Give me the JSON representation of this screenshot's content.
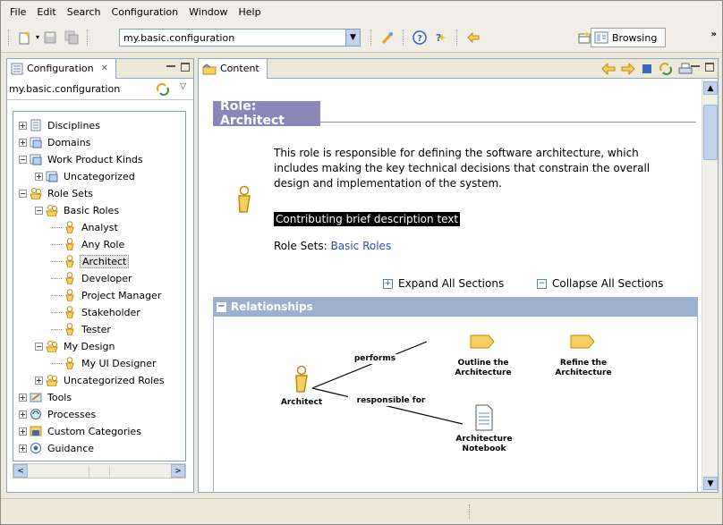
{
  "menubar": {
    "items": [
      {
        "label": "File"
      },
      {
        "label": "Edit"
      },
      {
        "label": "Search"
      },
      {
        "label": "Configuration"
      },
      {
        "label": "Window"
      },
      {
        "label": "Help"
      }
    ]
  },
  "toolbar": {
    "config_combo_value": "my.basic.configuration",
    "perspective_label": "Browsing",
    "overflow": "»"
  },
  "library_view": {
    "tab_label": "Configuration",
    "config_name": "my.basic.configuration",
    "tree": [
      {
        "label": "Disciplines",
        "level": 0,
        "expander": "+"
      },
      {
        "label": "Domains",
        "level": 0,
        "expander": "+"
      },
      {
        "label": "Work Product Kinds",
        "level": 0,
        "expander": "-"
      },
      {
        "label": "Uncategorized",
        "level": 1,
        "expander": "+"
      },
      {
        "label": "Role Sets",
        "level": 0,
        "expander": "-"
      },
      {
        "label": "Basic Roles",
        "level": 1,
        "expander": "-"
      },
      {
        "label": "Analyst",
        "level": 2,
        "expander": ""
      },
      {
        "label": "Any Role",
        "level": 2,
        "expander": ""
      },
      {
        "label": "Architect",
        "level": 2,
        "expander": "",
        "selected": true
      },
      {
        "label": "Developer",
        "level": 2,
        "expander": ""
      },
      {
        "label": "Project Manager",
        "level": 2,
        "expander": ""
      },
      {
        "label": "Stakeholder",
        "level": 2,
        "expander": ""
      },
      {
        "label": "Tester",
        "level": 2,
        "expander": ""
      },
      {
        "label": "My Design",
        "level": 1,
        "expander": "-"
      },
      {
        "label": "My UI Designer",
        "level": 2,
        "expander": ""
      },
      {
        "label": "Uncategorized Roles",
        "level": 1,
        "expander": "+"
      },
      {
        "label": "Tools",
        "level": 0,
        "expander": "+"
      },
      {
        "label": "Processes",
        "level": 0,
        "expander": "+"
      },
      {
        "label": "Custom Categories",
        "level": 0,
        "expander": "+"
      },
      {
        "label": "Guidance",
        "level": 0,
        "expander": "+"
      }
    ]
  },
  "content_view": {
    "tab_label": "Content",
    "page_title": "Role: Architect",
    "description": "This role is responsible for defining the software architecture, which includes making the key technical decisions that constrain the overall design and implementation of the system.",
    "contributing_text": "Contributing brief description text",
    "role_sets_label": "Role Sets:",
    "role_sets_link": "Basic Roles",
    "expand_all": "Expand All Sections",
    "collapse_all": "Collapse All Sections",
    "relationships_header": "Relationships",
    "diagram": {
      "role": "Architect",
      "performs": "performs",
      "responsible_for": "responsible for",
      "task1": "Outline the Architecture",
      "task2": "Refine the Architecture",
      "workproduct": "Architecture Notebook"
    }
  },
  "colors": {
    "title_bg": "#8b86b8",
    "section_bar": "#9bb1cf",
    "link": "#2a4fae",
    "role_icon": "#f0c040"
  }
}
